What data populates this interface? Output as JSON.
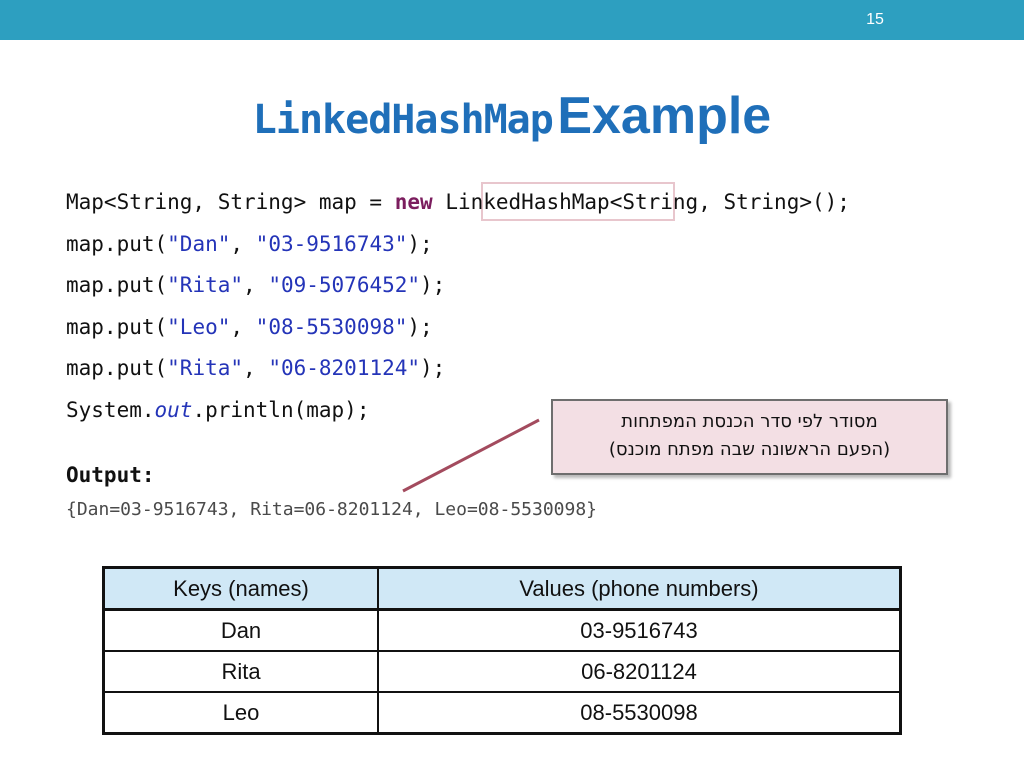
{
  "slide": {
    "number": "15",
    "title_code": "LinkedHashMap",
    "title_word": "Example"
  },
  "code": {
    "line1": {
      "prefix": "Map<String, String> map = ",
      "keyword": "new",
      "mid": " LinkedHashMap",
      "suffix": "<String, String>();"
    },
    "puts": [
      {
        "key": "\"Dan\"",
        "value": "\"03-9516743\""
      },
      {
        "key": "\"Rita\"",
        "value": "\"09-5076452\""
      },
      {
        "key": "\"Leo\"",
        "value": "\"08-5530098\""
      },
      {
        "key": "\"Rita\"",
        "value": "\"06-8201124\""
      }
    ],
    "put_prefix": "map.put(",
    "put_sep": ", ",
    "put_suffix": ");",
    "print": {
      "prefix": "System.",
      "field": "out",
      "suffix": ".println(map);"
    }
  },
  "output": {
    "label": "Output:",
    "text": "{Dan=03-9516743, Rita=06-8201124, Leo=08-5530098}"
  },
  "callout": {
    "line1": "מסודר לפי סדר הכנסת המפתחות",
    "line2": "(הפעם הראשונה שבה מפתח מוכנס)"
  },
  "table": {
    "headers": [
      "Keys (names)",
      "Values (phone numbers)"
    ],
    "rows": [
      [
        "Dan",
        "03-9516743"
      ],
      [
        "Rita",
        "06-8201124"
      ],
      [
        "Leo",
        "08-5530098"
      ]
    ]
  },
  "colors": {
    "topbar": "#2d9fc0",
    "title": "#1f6fb9",
    "keyword": "#7b1d5e",
    "string": "#2434b8",
    "callout_fill": "#f3dfe4",
    "header_fill": "#d0e8f6"
  }
}
